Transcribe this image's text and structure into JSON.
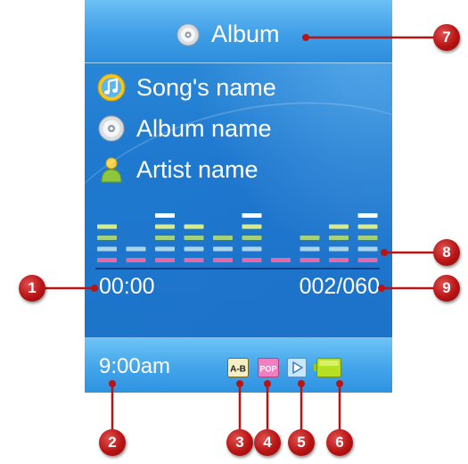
{
  "header": {
    "title": "Album",
    "icon": "cd-icon"
  },
  "now_playing": {
    "song": {
      "label": "Song's name",
      "icon": "music-note-icon"
    },
    "album": {
      "label": "Album name",
      "icon": "cd-icon"
    },
    "artist": {
      "label": "Artist name",
      "icon": "artist-person-icon"
    }
  },
  "equalizer": {
    "bar_levels": [
      4,
      2,
      5,
      4,
      3,
      5,
      1,
      3,
      4,
      5
    ],
    "segment_colors": [
      "#e36aa5",
      "#a9d4ea",
      "#a4d27a",
      "#d6ec8c",
      "#ffffff"
    ]
  },
  "elapsed_time": "00:00",
  "track_counter": "002/060",
  "status": {
    "clock": "9:00am",
    "ab_repeat": "A-B",
    "eq_mode": "POP",
    "play_icon": "play-mode-icon",
    "battery_icon": "battery-icon"
  },
  "callouts": [
    "1",
    "2",
    "3",
    "4",
    "5",
    "6",
    "7",
    "8",
    "9"
  ],
  "colors": {
    "screen_blue": "#1f79cf",
    "callout_red": "#b81414",
    "battery_green": "#b6e023"
  }
}
